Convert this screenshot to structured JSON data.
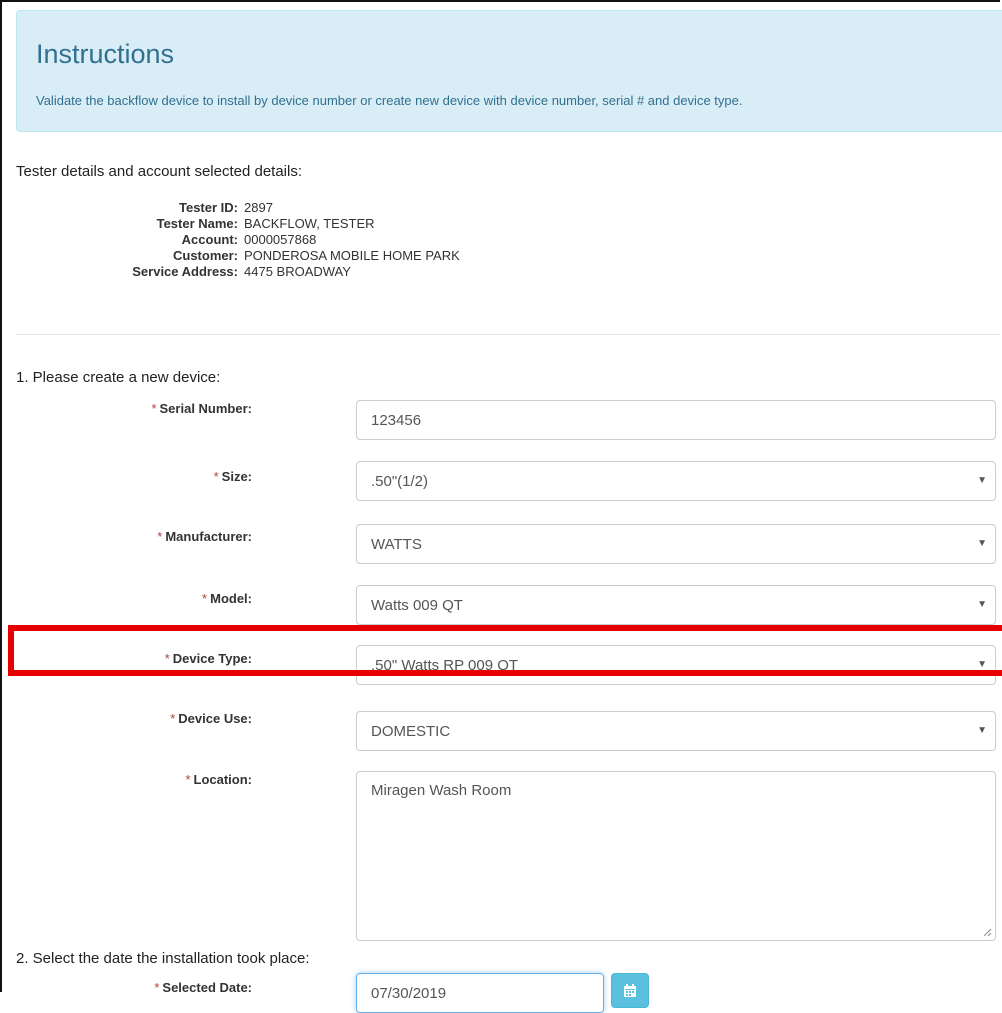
{
  "instructions": {
    "title": "Instructions",
    "text": "Validate the backflow device to install by device number or create new device with device number, serial # and device type."
  },
  "tester_section": {
    "heading": "Tester details and account selected details:",
    "rows": [
      {
        "label": "Tester ID:",
        "value": "2897"
      },
      {
        "label": "Tester Name:",
        "value": "BACKFLOW, TESTER"
      },
      {
        "label": "Account:",
        "value": "0000057868"
      },
      {
        "label": "Customer:",
        "value": "PONDEROSA MOBILE HOME PARK"
      },
      {
        "label": "Service Address:",
        "value": "4475 BROADWAY"
      }
    ]
  },
  "step1": {
    "heading": "1. Please create a new device:",
    "required_mark": "*",
    "fields": {
      "serial": {
        "label": "Serial Number:",
        "value": "123456"
      },
      "size": {
        "label": "Size:",
        "value": ".50\"(1/2)"
      },
      "manufacturer": {
        "label": "Manufacturer:",
        "value": "WATTS"
      },
      "model": {
        "label": "Model:",
        "value": "Watts 009 QT"
      },
      "device_type": {
        "label": "Device Type:",
        "value": ".50\" Watts RP 009 QT"
      },
      "device_use": {
        "label": "Device Use:",
        "value": "DOMESTIC"
      },
      "location": {
        "label": "Location:",
        "value": "Miragen Wash Room"
      }
    }
  },
  "step2": {
    "heading": "2. Select the date the installation took place:",
    "date_label": "Selected Date:",
    "date_value": "07/30/2019"
  },
  "colors": {
    "info_bg": "#d9edf7",
    "info_text": "#31708f",
    "highlight": "#e60000",
    "calendar_button": "#5bc0de",
    "required": "#a94442"
  },
  "icons": {
    "select_arrow": "▼",
    "calendar": "calendar-icon"
  }
}
